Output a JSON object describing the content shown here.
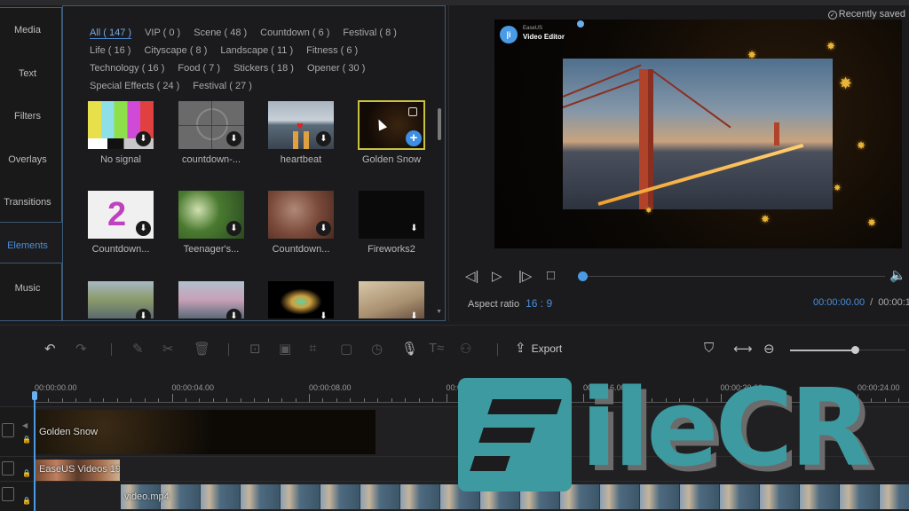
{
  "sidebar": {
    "items": [
      {
        "label": "Media",
        "active": false
      },
      {
        "label": "Text",
        "active": false
      },
      {
        "label": "Filters",
        "active": false
      },
      {
        "label": "Overlays",
        "active": false
      },
      {
        "label": "Transitions",
        "active": false
      },
      {
        "label": "Elements",
        "active": true
      },
      {
        "label": "Music",
        "active": false
      }
    ]
  },
  "library": {
    "category_rows": [
      [
        "All ( 147 )",
        "VIP ( 0 )",
        "Scene ( 48 )",
        "Countdown ( 6 )",
        "Festival ( 8 )"
      ],
      [
        "Life ( 16 )",
        "Cityscape ( 8 )",
        "Landscape ( 11 )",
        "Fitness ( 6 )"
      ],
      [
        "Technology ( 16 )",
        "Food ( 7 )",
        "Stickers ( 18 )",
        "Opener ( 30 )"
      ],
      [
        "Special Effects ( 24 )",
        "Festival ( 27 )"
      ]
    ],
    "active_category": "All ( 147 )",
    "items": [
      {
        "label": "No signal",
        "icon": "download-icon"
      },
      {
        "label": "countdown-...",
        "icon": "download-icon"
      },
      {
        "label": "heartbeat",
        "icon": "download-icon"
      },
      {
        "label": "Golden Snow",
        "icon": "add-icon",
        "selected": true
      },
      {
        "label": "Countdown...",
        "icon": "download-icon"
      },
      {
        "label": "Teenager's...",
        "icon": "download-icon"
      },
      {
        "label": "Countdown...",
        "icon": "download-icon"
      },
      {
        "label": "Fireworks2",
        "icon": "download-icon"
      },
      {
        "label": "",
        "icon": "download-icon"
      },
      {
        "label": "",
        "icon": "download-icon"
      },
      {
        "label": "",
        "icon": "download-icon"
      },
      {
        "label": "",
        "icon": "download-icon"
      }
    ],
    "download_glyph": "⬇",
    "add_glyph": "+"
  },
  "preview": {
    "saved_status": "Recently saved",
    "watermark_small": "EaseUS",
    "watermark_big": "Video Editor",
    "watermark_logo": "|i",
    "aspect_label": "Aspect ratio",
    "aspect_value": "16 : 9",
    "current_time": "00:00:00.00",
    "separator": "/",
    "total_time": "00:00:1",
    "controls": {
      "prev": "◁|",
      "play": "▷",
      "next": "|▷",
      "stop": "□",
      "volume": "🔈"
    },
    "progress": 0
  },
  "toolbar": {
    "export_label": "Export",
    "export_icon": "⇪",
    "icons": {
      "undo": "↶",
      "redo": "↷",
      "edit": "✎",
      "cut": "✂",
      "delete": "🗑",
      "crop": "⊡",
      "resize": "▣",
      "mosaic": "⌗",
      "freeze": "▢",
      "speed": "◷",
      "record": "🎙",
      "text_to_speech": "T≈",
      "portrait": "⚇",
      "marker": "⛉",
      "fit": "⟷",
      "zoom_out": "⊖"
    },
    "zoom_level": 0.56
  },
  "timeline": {
    "ruler_labels": [
      "00:00:00.00",
      "00:00:04.00",
      "00:00:08.00",
      "00:00:12.00",
      "00:00:16.00",
      "00:00:20.00",
      "00:00:24.00"
    ],
    "tracks": [
      {
        "clip_label": "Golden Snow",
        "type": "overlay"
      },
      {
        "clip_label": "EaseUS Videos 19",
        "type": "image"
      },
      {
        "clip_label": "video.mp4",
        "type": "video"
      }
    ]
  },
  "overlay_watermark": {
    "text": "ileCR",
    "brand_color": "#3d9aa0"
  },
  "colors": {
    "accent": "#4a8ed8",
    "selection": "#c8c23c",
    "panel_border": "#3b5a7a"
  }
}
